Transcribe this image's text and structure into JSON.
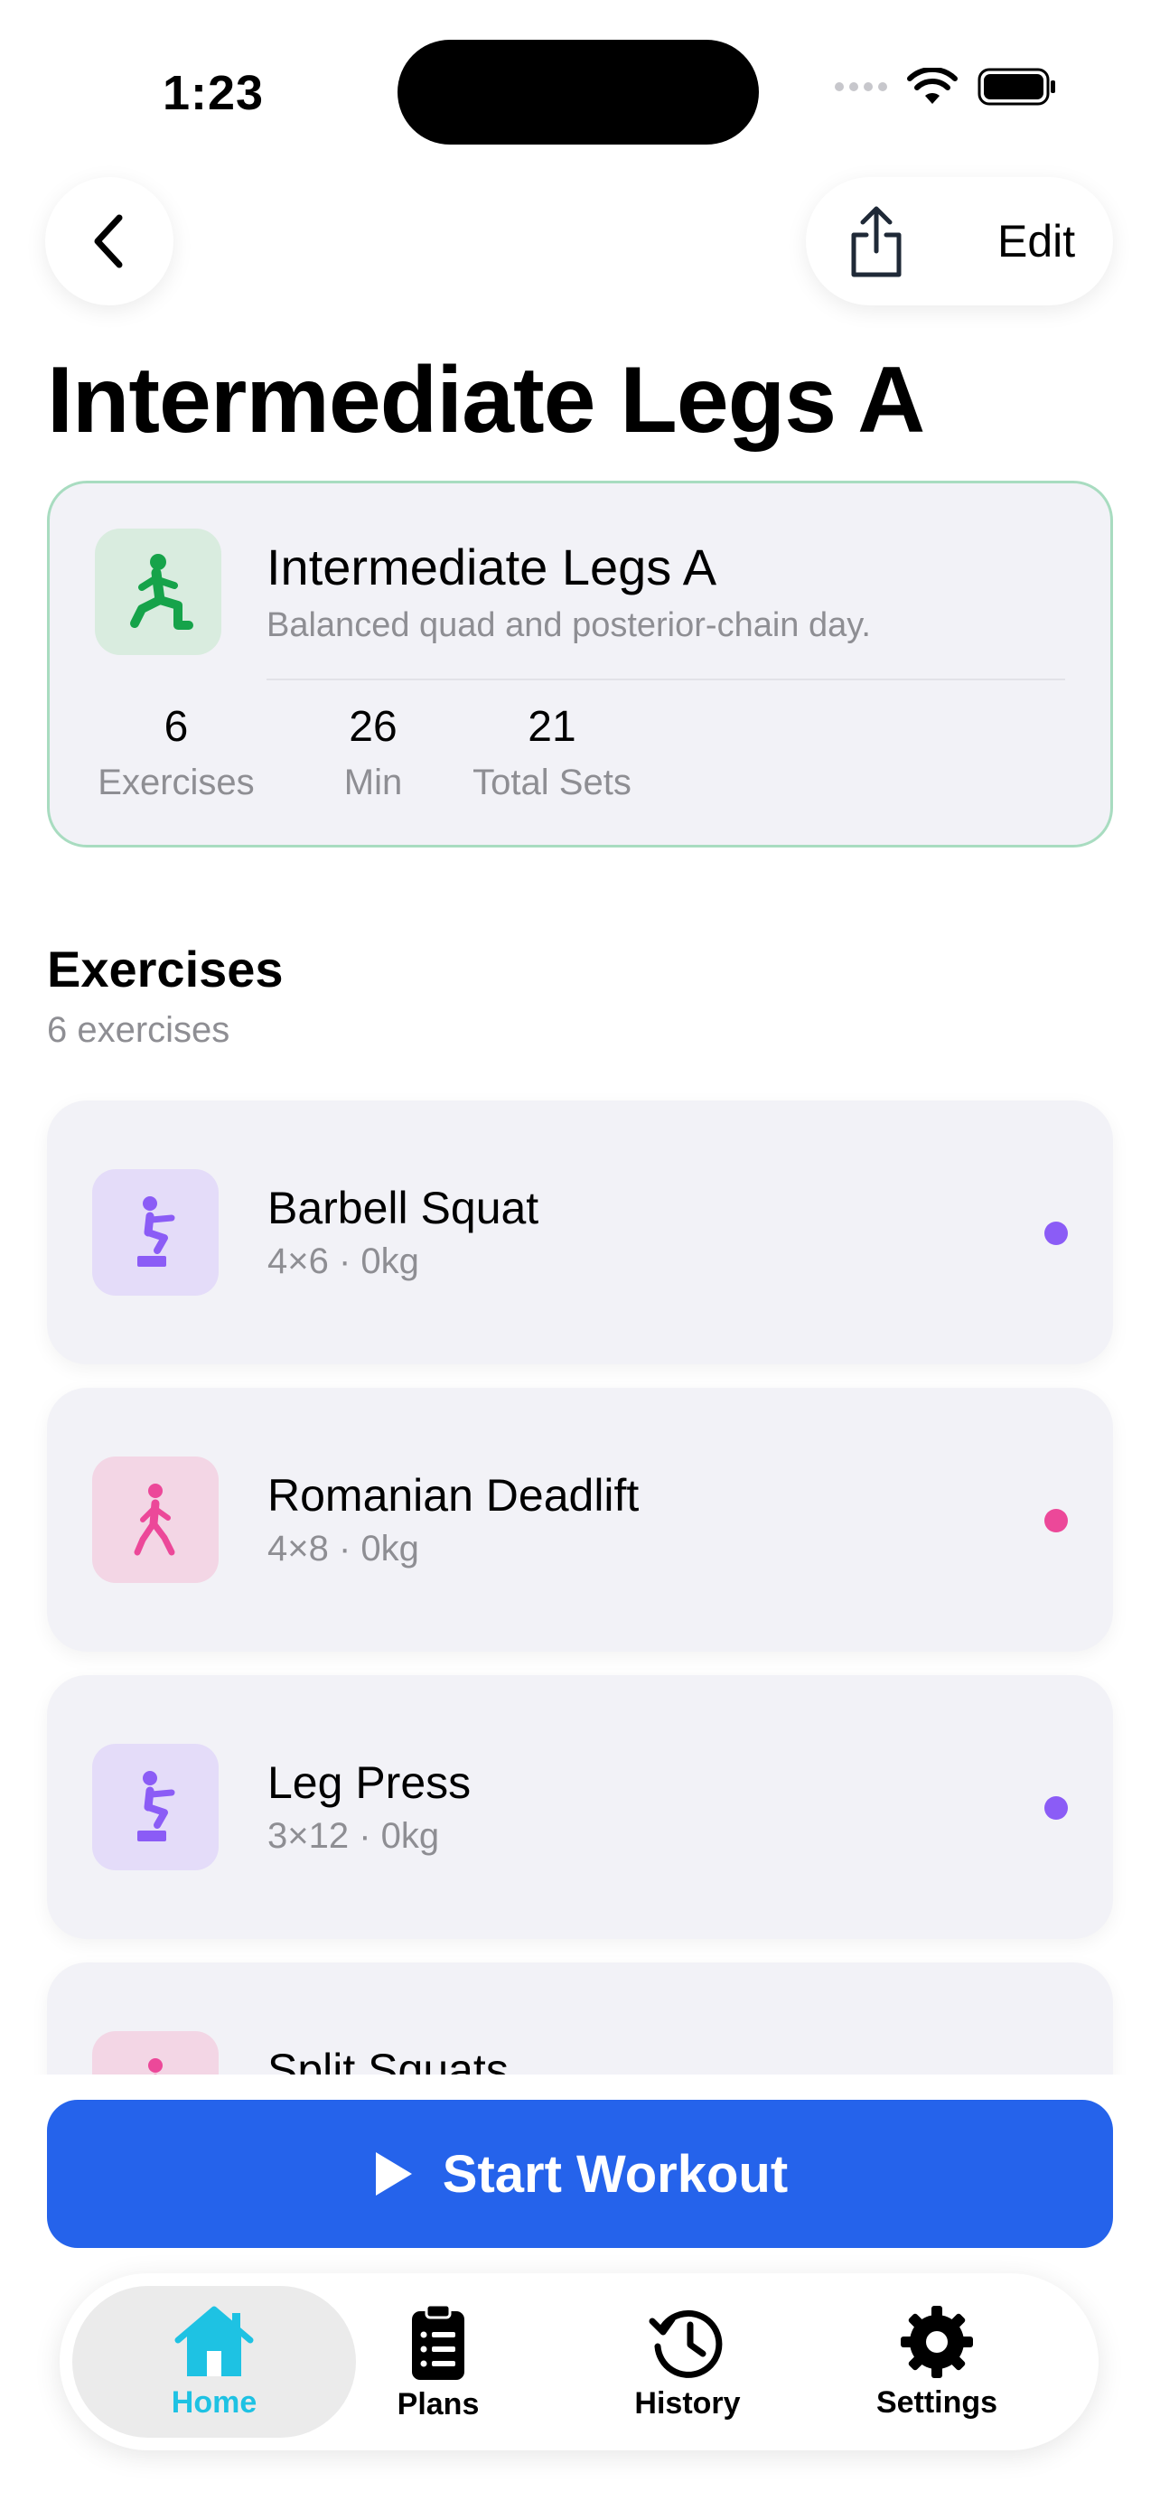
{
  "status_bar": {
    "time": "1:23"
  },
  "header": {
    "edit_label": "Edit"
  },
  "page": {
    "title": "Intermediate Legs A"
  },
  "summary": {
    "name": "Intermediate Legs A",
    "description": "Balanced quad and posterior-chain day.",
    "stats": [
      {
        "value": "6",
        "label": "Exercises"
      },
      {
        "value": "26",
        "label": "Min"
      },
      {
        "value": "21",
        "label": "Total Sets"
      }
    ],
    "accent": "#16a34a"
  },
  "exercises_section": {
    "title": "Exercises",
    "subtitle": "6 exercises",
    "items": [
      {
        "name": "Barbell Squat",
        "detail": "4×6 · 0kg",
        "icon": "squat-icon",
        "color": "#8b5cf6",
        "bg": "#e4dcf9"
      },
      {
        "name": "Romanian Deadlift",
        "detail": "4×8 · 0kg",
        "icon": "walking-figure-icon",
        "color": "#ec4899",
        "bg": "#f3d6e5"
      },
      {
        "name": "Leg Press",
        "detail": "3×12 · 0kg",
        "icon": "squat-icon",
        "color": "#8b5cf6",
        "bg": "#e4dcf9"
      },
      {
        "name": "Split Squats",
        "detail": "",
        "icon": "lunge-icon",
        "color": "#ec4899",
        "bg": "#f3d6e5"
      }
    ]
  },
  "start_button": {
    "label": "Start Workout",
    "color": "#2563eb"
  },
  "tab_bar": {
    "tabs": [
      {
        "label": "Home",
        "icon": "house-icon",
        "active": true
      },
      {
        "label": "Plans",
        "icon": "clipboard-list-icon",
        "active": false
      },
      {
        "label": "History",
        "icon": "history-clock-icon",
        "active": false
      },
      {
        "label": "Settings",
        "icon": "gear-icon",
        "active": false
      }
    ],
    "active_color": "#1ec2e3"
  }
}
